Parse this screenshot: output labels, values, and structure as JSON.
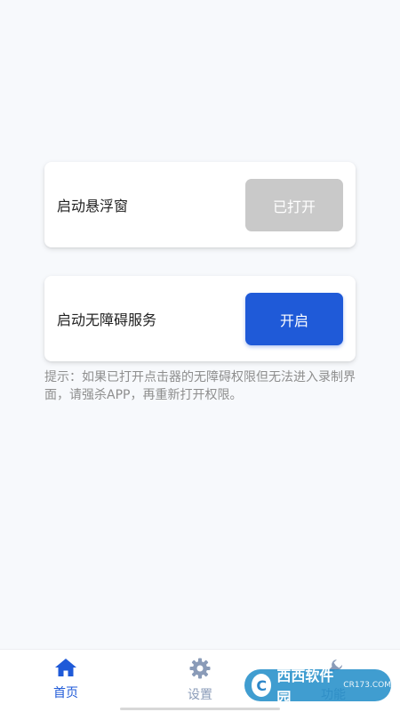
{
  "cards": [
    {
      "label": "启动悬浮窗",
      "button": "已打开"
    },
    {
      "label": "启动无障碍服务",
      "button": "开启"
    }
  ],
  "hint": "提示：如果已打开点击器的无障碍权限但无法进入录制界面，请强杀APP，再重新打开权限。",
  "nav": {
    "home": "首页",
    "settings": "设置",
    "feature": "功能"
  },
  "watermark": {
    "text": "西西软件园",
    "sub": "CR173.COM"
  },
  "colors": {
    "primary": "#1f5ad8",
    "disabled": "#c9c9c9",
    "background": "#f7f9fc"
  }
}
